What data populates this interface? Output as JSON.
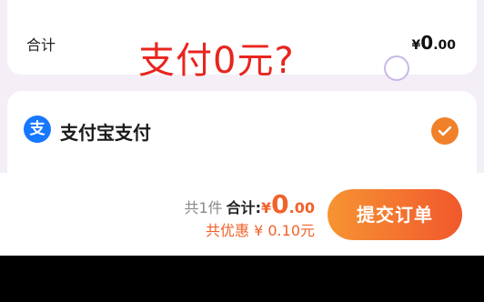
{
  "order_total": {
    "label": "合计",
    "currency": "¥",
    "amount_int": "0",
    "amount_dec": ".00"
  },
  "overlay_caption": "支付0元?",
  "payment_method": {
    "icon_char": "支",
    "label": "支付宝支付",
    "selected": true
  },
  "checkout": {
    "count_text": "共1件",
    "total_label": "合计:",
    "currency": "¥",
    "amount_int": "0",
    "amount_dec": ".00",
    "discount_text": "共优惠 ¥ 0.10元",
    "submit_label": "提交订单"
  },
  "colors": {
    "accent": "#f0622a",
    "alipay_blue": "#1677ff",
    "overlay_red": "#e8251e"
  }
}
